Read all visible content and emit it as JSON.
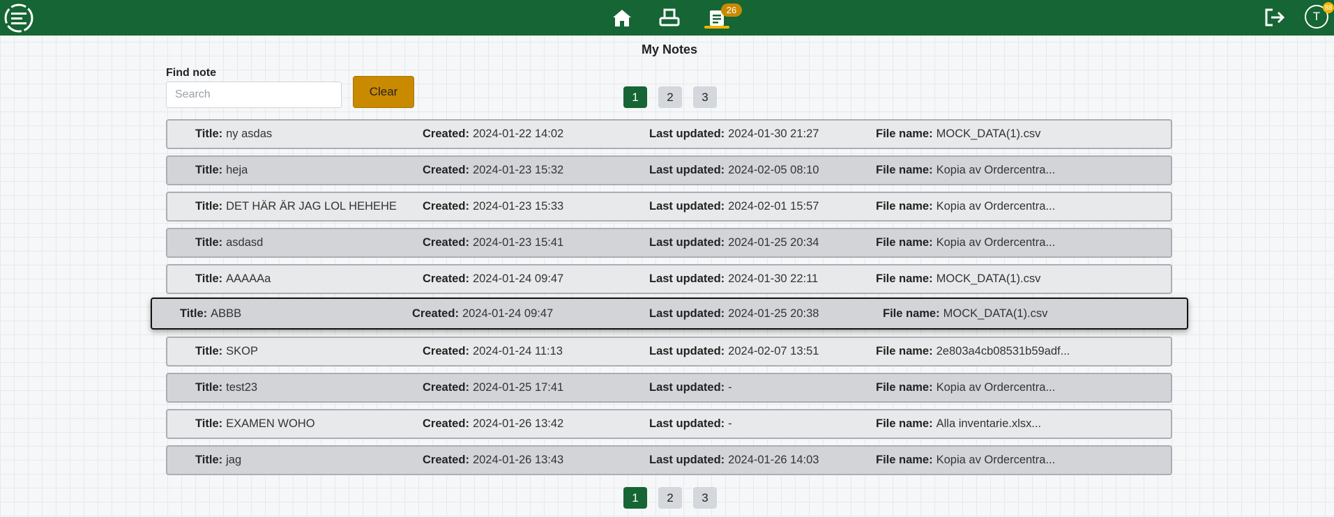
{
  "nav": {
    "badge_count": "26",
    "avatar_initial": "T",
    "avatar_badge": "88",
    "icons": [
      "logo-icon",
      "home-icon",
      "printer-icon",
      "notes-icon",
      "logout-icon"
    ],
    "accent_color": "#166534",
    "highlight_color": "#f2b400"
  },
  "page": {
    "title": "My Notes"
  },
  "search": {
    "label": "Find note",
    "placeholder": "Search",
    "value": "",
    "clear_label": "Clear"
  },
  "pagination": {
    "pages": [
      "1",
      "2",
      "3"
    ],
    "active": "1"
  },
  "labels": {
    "title": "Title:",
    "created": "Created:",
    "updated": "Last updated:",
    "file": "File name:"
  },
  "notes": [
    {
      "title": "ny asdas",
      "created": "2024-01-22 14:02",
      "updated": "2024-01-30 21:27",
      "file": "MOCK_DATA(1).csv"
    },
    {
      "title": "heja",
      "created": "2024-01-23 15:32",
      "updated": "2024-02-05 08:10",
      "file": "Kopia av Ordercentra..."
    },
    {
      "title": "DET HÄR ÄR JAG LOL HEHEHE",
      "created": "2024-01-23 15:33",
      "updated": "2024-02-01 15:57",
      "file": "Kopia av Ordercentra..."
    },
    {
      "title": "asdasd",
      "created": "2024-01-23 15:41",
      "updated": "2024-01-25 20:34",
      "file": "Kopia av Ordercentra..."
    },
    {
      "title": "AAAAAa",
      "created": "2024-01-24 09:47",
      "updated": "2024-01-30 22:11",
      "file": "MOCK_DATA(1).csv"
    },
    {
      "title": "ABBB",
      "created": "2024-01-24 09:47",
      "updated": "2024-01-25 20:38",
      "file": "MOCK_DATA(1).csv"
    },
    {
      "title": "SKOP",
      "created": "2024-01-24 11:13",
      "updated": "2024-02-07 13:51",
      "file": "2e803a4cb08531b59adf..."
    },
    {
      "title": "test23",
      "created": "2024-01-25 17:41",
      "updated": "-",
      "file": "Kopia av Ordercentra..."
    },
    {
      "title": "EXAMEN WOHO",
      "created": "2024-01-26 13:42",
      "updated": "-",
      "file": "Alla inventarie.xlsx..."
    },
    {
      "title": "jag",
      "created": "2024-01-26 13:43",
      "updated": "2024-01-26 14:03",
      "file": "Kopia av Ordercentra..."
    }
  ],
  "highlighted_row": 5
}
